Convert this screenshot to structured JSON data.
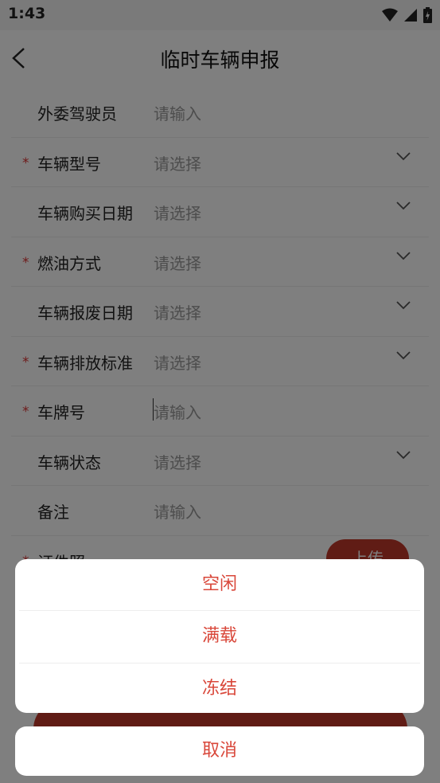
{
  "status": {
    "time": "1:43"
  },
  "header": {
    "title": "临时车辆申报"
  },
  "form": {
    "rows": [
      {
        "label": "外委驾驶员",
        "value": "请输入",
        "required": false,
        "dropdown": false
      },
      {
        "label": "车辆型号",
        "value": "请选择",
        "required": true,
        "dropdown": true
      },
      {
        "label": "车辆购买日期",
        "value": "请选择",
        "required": false,
        "dropdown": true
      },
      {
        "label": "燃油方式",
        "value": "请选择",
        "required": true,
        "dropdown": true
      },
      {
        "label": "车辆报废日期",
        "value": "请选择",
        "required": false,
        "dropdown": true
      },
      {
        "label": "车辆排放标准",
        "value": "请选择",
        "required": true,
        "dropdown": true
      },
      {
        "label": "车牌号",
        "value": "请输入",
        "required": true,
        "dropdown": false
      },
      {
        "label": "车辆状态",
        "value": "请选择",
        "required": false,
        "dropdown": true
      },
      {
        "label": "备注",
        "value": "请输入",
        "required": false,
        "dropdown": false
      }
    ],
    "certificate_label": "证件照",
    "upload_label": "上传",
    "required_mark": "*"
  },
  "action_sheet": {
    "options": [
      "空闲",
      "满载",
      "冻结"
    ],
    "cancel_label": "取消"
  },
  "colors": {
    "accent": "#c0392b",
    "sheet_text": "#d9473a"
  }
}
